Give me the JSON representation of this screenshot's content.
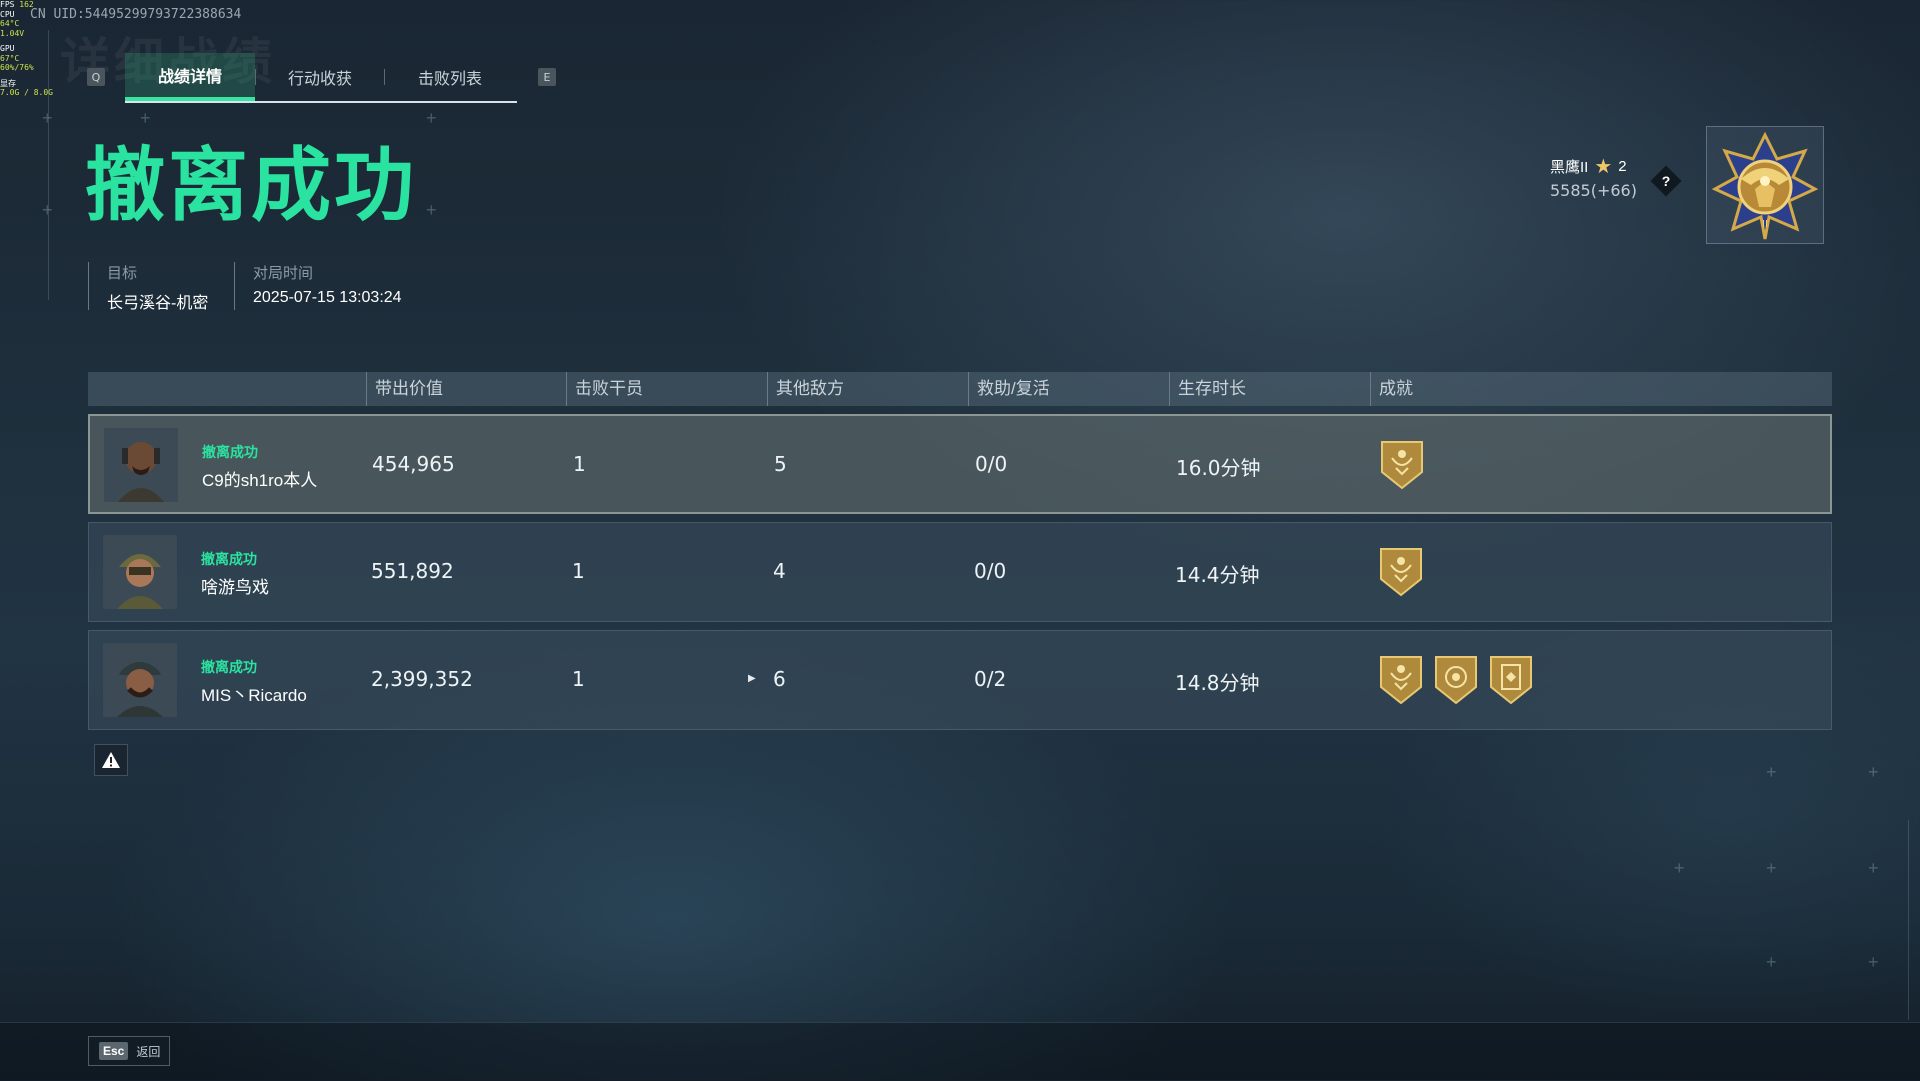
{
  "hud": {
    "fps_label": "FPS",
    "fps": "162",
    "cpu_label": "CPU",
    "cpu_temp": "64°C",
    "cpu_volt": "1.04V",
    "gpu_label": "GPU",
    "gpu_temp": "67°C",
    "gpu_usage": "60%/76%",
    "mem_label": "显存",
    "mem": "7.0G / 8.0G"
  },
  "uid": "CN UID:5449529979372238863​4",
  "bg_title": "详细战绩",
  "tabs": {
    "prev_key": "Q",
    "next_key": "E",
    "items": [
      "战绩详情",
      "行动收获",
      "击败列表"
    ]
  },
  "title": "撤离成功",
  "info": {
    "target_label": "目标",
    "target_value": "长弓溪谷-机密",
    "time_label": "对局时间",
    "time_value": "2025-07-15 13:03:24"
  },
  "rank": {
    "name": "黑鹰II",
    "stars": "2",
    "score": "5585(+66)",
    "help": "?"
  },
  "table": {
    "headers": [
      "带出价值",
      "击败干员",
      "其他敌方",
      "救助/复活",
      "生存时长",
      "成就"
    ],
    "rows": [
      {
        "status": "撤离成功",
        "player": "C9的sh1ro本人",
        "value": "454,965",
        "kills": "1",
        "others": "5",
        "assists": "0/0",
        "survival": "16.0分钟",
        "achievements": [
          "shield-badge"
        ]
      },
      {
        "status": "撤离成功",
        "player": "啥游鸟戏",
        "value": "551,892",
        "kills": "1",
        "others": "4",
        "assists": "0/0",
        "survival": "14.4分钟",
        "achievements": [
          "shield-badge"
        ]
      },
      {
        "status": "撤离成功",
        "player": "MIS丶Ricardo",
        "value": "2,399,352",
        "kills": "1",
        "others": "6",
        "assists": "0/2",
        "survival": "14.8分钟",
        "achievements": [
          "shield-badge",
          "target-badge",
          "card-badge"
        ]
      }
    ]
  },
  "footer": {
    "esc_key": "Esc",
    "back_label": "返回"
  },
  "colors": {
    "accent": "#2be3a0",
    "gold": "#c9a24a"
  }
}
